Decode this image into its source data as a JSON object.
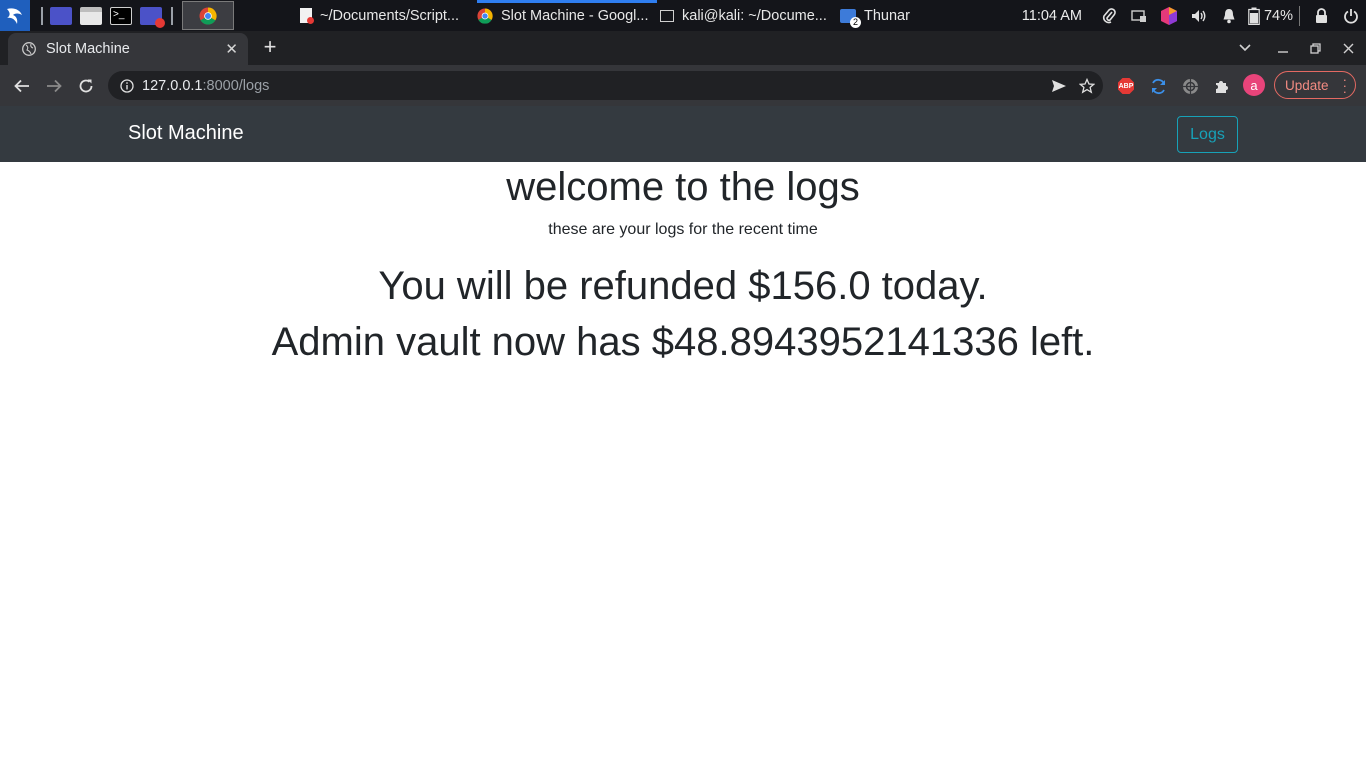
{
  "os": {
    "windows": [
      {
        "label": "~/Documents/Script...",
        "active": false
      },
      {
        "label": "Slot Machine - Googl...",
        "active": true
      },
      {
        "label": "kali@kali: ~/Docume...",
        "active": false
      },
      {
        "label": "Thunar",
        "active": false
      }
    ],
    "clock": "11:04 AM",
    "battery": "74%",
    "thunar_badge": "2"
  },
  "browser": {
    "tab_title": "Slot Machine",
    "url_host": "127.0.0.1",
    "url_rest": ":8000/logs",
    "avatar_letter": "a",
    "update_label": "Update",
    "abp_label": "ABP"
  },
  "page": {
    "brand": "Slot Machine",
    "nav_logs": "Logs",
    "heading": "welcome to the logs",
    "subheading": "these are your logs for the recent time",
    "refund_line": "You will be refunded $156.0 today.",
    "vault_line": "Admin vault now has $48.8943952141336 left."
  },
  "colors": {
    "navbar": "#343a40",
    "logs_accent": "#17a2b8",
    "text": "#212529"
  }
}
